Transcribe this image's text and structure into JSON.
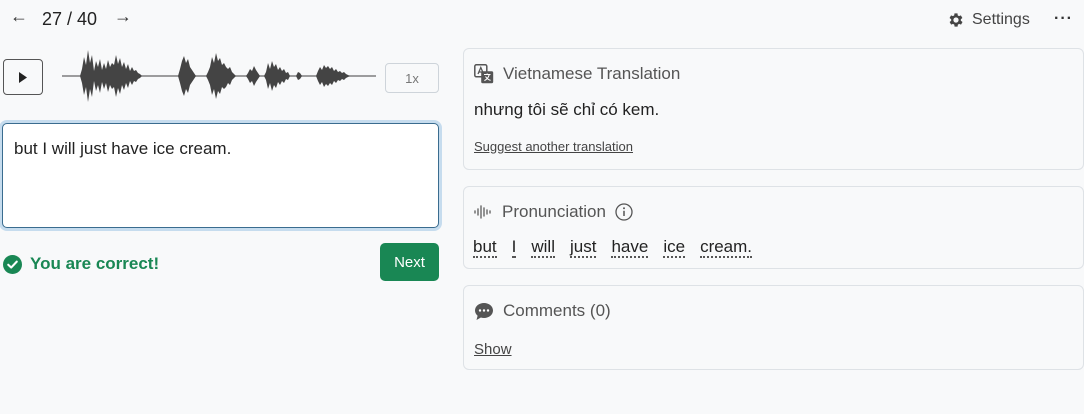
{
  "nav": {
    "prev_icon": "←",
    "next_icon": "→",
    "counter": "27 / 40"
  },
  "header": {
    "settings_label": "Settings",
    "more_label": "···"
  },
  "player": {
    "speed_label": "1x"
  },
  "answer": {
    "value": "but I will just have ice cream."
  },
  "feedback": {
    "message": "You are correct!",
    "next_label": "Next",
    "color": "#198754"
  },
  "translation": {
    "title": "Vietnamese Translation",
    "text": "nhưng tôi sẽ chỉ có kem.",
    "suggest_link": "Suggest another translation"
  },
  "pronunciation": {
    "title": "Pronunciation",
    "words": [
      "but",
      "I",
      "will",
      "just",
      "have",
      "ice",
      "cream."
    ]
  },
  "comments": {
    "title": "Comments (0)",
    "show_link": "Show"
  }
}
